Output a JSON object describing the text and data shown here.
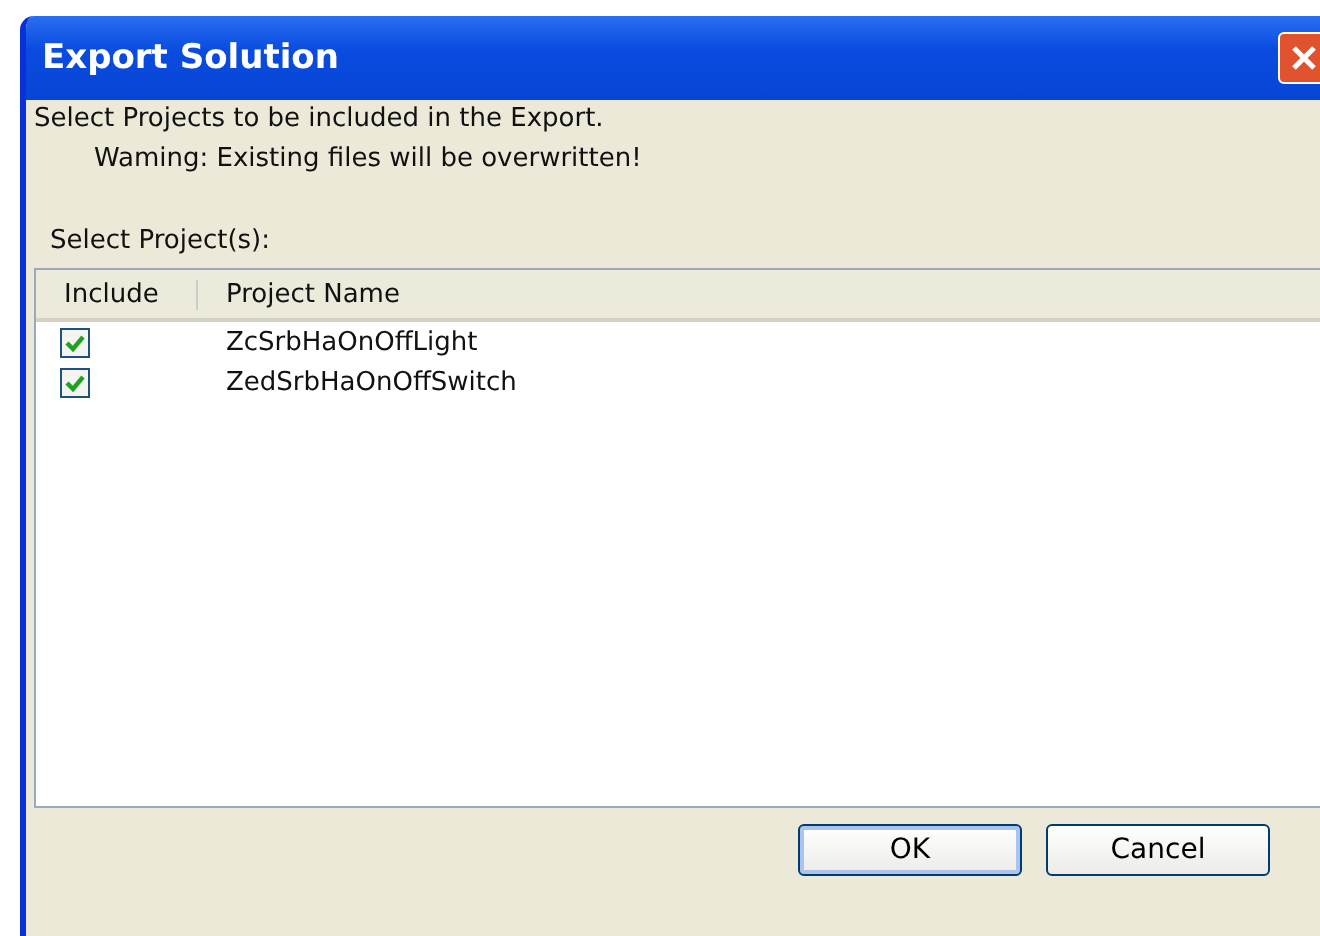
{
  "window": {
    "title": "Export Solution"
  },
  "intro": "Select Projects to be included in the Export.",
  "warning": "Waming: Existing files will be overwritten!",
  "list_label": "Select Project(s):",
  "table": {
    "columns": [
      "Include",
      "Project Name"
    ],
    "rows": [
      {
        "name": "ZcSrbHaOnOffLight",
        "checked": true
      },
      {
        "name": "ZedSrbHaOnOffSwitch",
        "checked": true
      }
    ]
  },
  "buttons": [
    "OK",
    "Cancel"
  ]
}
